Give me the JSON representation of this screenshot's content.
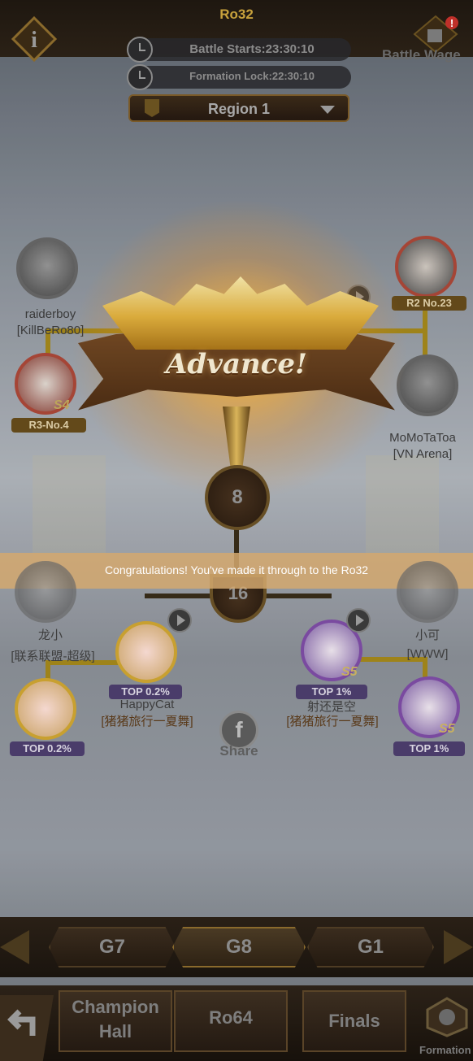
{
  "header": {
    "title": "Ro32",
    "info_icon": "info-icon",
    "battle_wager_label": "Battle Wage",
    "battle_starts": "Battle Starts:23:30:10",
    "formation_lock": "Formation Lock:22:30:10",
    "region": "Region 1"
  },
  "bracket": {
    "top_left_1": {
      "name": "raiderboy",
      "guild": "[KillBeRo80]"
    },
    "top_left_2": {
      "rank": "R3-No.4",
      "tier": "S4"
    },
    "top_right_1": {
      "rank": "R2 No.23"
    },
    "top_right_2": {
      "name": "MoMoTaToa",
      "guild": "[VN Arena]"
    },
    "center_number": "8",
    "lower_center_number": "16",
    "bottom_left_1": {
      "name": "龙小",
      "guild": "[联系联盟-超级]"
    },
    "bottom_left_2": {
      "rank": "TOP 0.2%",
      "name": "HappyCat",
      "guild": "[猪猪旅行一夏舞]"
    },
    "bottom_left_3": {
      "rank": "TOP 0.2%"
    },
    "bottom_right_1": {
      "name": "小可",
      "guild": "[WWW]"
    },
    "bottom_right_2": {
      "rank": "TOP 1%",
      "name": "射还是空",
      "guild": "[猪猪旅行一夏舞]",
      "tier": "S5"
    },
    "bottom_right_3": {
      "rank": "TOP 1%",
      "tier": "S5"
    }
  },
  "overlay": {
    "advance_text": "Advance!",
    "congrats": "Congratulations! You've made it through to the Ro32"
  },
  "share": {
    "label": "Share",
    "icon": "facebook-icon"
  },
  "groups": {
    "prev": "G7",
    "current": "G8",
    "next": "G1"
  },
  "bottom_nav": {
    "champion_line1": "Champion",
    "champion_line2": "Hall",
    "ro64": "Ro64",
    "finals": "Finals",
    "formation": "Formation"
  }
}
